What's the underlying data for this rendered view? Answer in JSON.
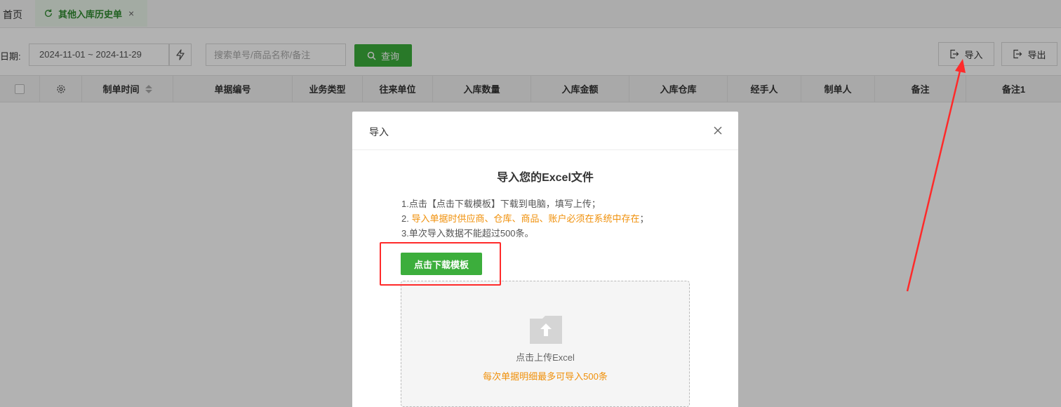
{
  "tabs": {
    "home_label": "首页",
    "active_label": "其他入库历史单",
    "close_glyph": "×"
  },
  "filter": {
    "date_label": "日期:",
    "date_range": "2024-11-01 ~ 2024-11-29",
    "search_placeholder": "搜索单号/商品名称/备注",
    "query_label": "查询",
    "import_label": "导入",
    "export_label": "导出"
  },
  "table": {
    "columns": [
      "制单时间",
      "单据编号",
      "业务类型",
      "往来单位",
      "入库数量",
      "入库金额",
      "入库仓库",
      "经手人",
      "制单人",
      "备注",
      "备注1"
    ]
  },
  "modal": {
    "title": "导入",
    "heading": "导入您的Excel文件",
    "line1": "1.点击【点击下载模板】下载到电脑，填写上传；",
    "line2_prefix": "2. ",
    "line2_highlight": "导入单据时供应商、仓库、商品、账户必须在系统中存在",
    "line2_suffix": "；",
    "line3": "3.单次导入数据不能超过500条。",
    "download_label": "点击下载模板",
    "upload_label": "点击上传Excel",
    "upload_hint": "每次单据明细最多可导入500条"
  },
  "colors": {
    "accent_green": "#3cae3c",
    "highlight_orange": "#f0900a",
    "annotation_red": "#ff2a2a"
  },
  "icons": [
    "refresh-icon",
    "bolt-icon",
    "search-icon",
    "import-icon",
    "export-icon",
    "gear-icon",
    "sort-icon",
    "close-icon",
    "upload-folder-icon"
  ]
}
